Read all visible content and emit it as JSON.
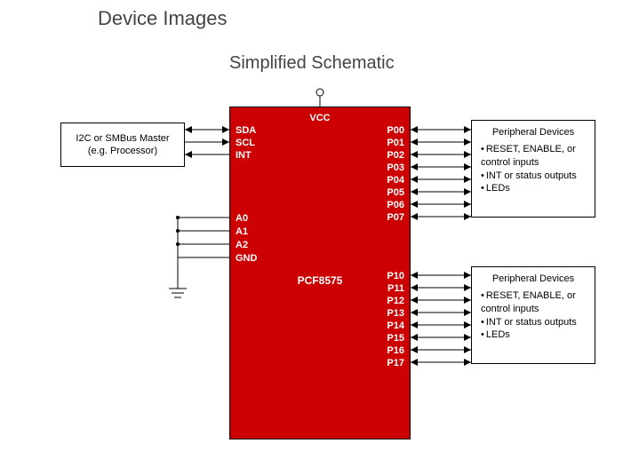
{
  "title": "Device Images",
  "subtitle": "Simplified Schematic",
  "chip": {
    "name": "PCF8575",
    "vcc": "VCC",
    "left_pins": [
      "SDA",
      "SCL",
      "INT",
      "A0",
      "A1",
      "A2",
      "GND"
    ],
    "right_pins_bank0": [
      "P00",
      "P01",
      "P02",
      "P03",
      "P04",
      "P05",
      "P06",
      "P07"
    ],
    "right_pins_bank1": [
      "P10",
      "P11",
      "P12",
      "P13",
      "P14",
      "P15",
      "P16",
      "P17"
    ]
  },
  "master": {
    "line1": "I2C or SMBus Master",
    "line2": "(e.g. Processor)"
  },
  "peripheral": {
    "header": "Peripheral Devices",
    "items": [
      "RESET, ENABLE, or control inputs",
      "INT or status outputs",
      "LEDs"
    ]
  }
}
